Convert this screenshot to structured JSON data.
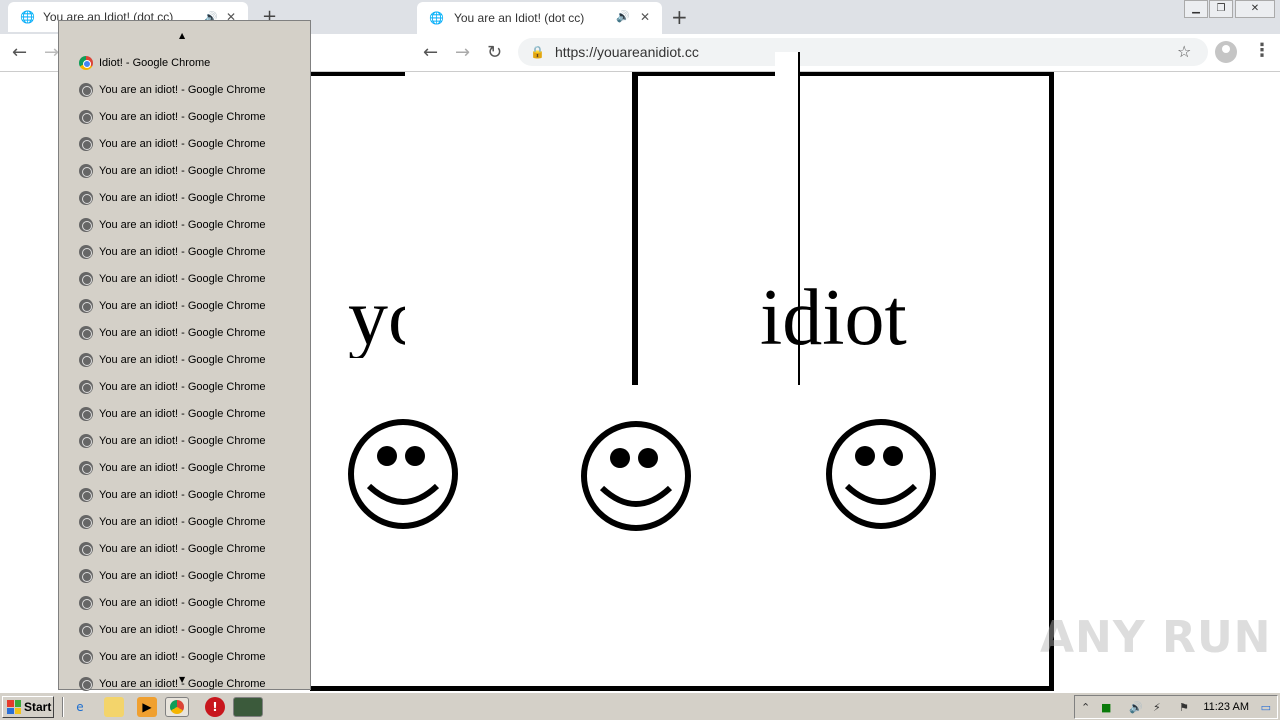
{
  "back_window": {
    "tab_title": "You are an Idiot! (dot cc)",
    "new_tab": "+",
    "back": "←",
    "forward": "→"
  },
  "front_window": {
    "tab_title": "You are an Idiot! (dot cc)",
    "new_tab": "+",
    "close_tab": "✕",
    "speaker": "🔊",
    "back": "←",
    "forward": "→",
    "reload": "↻",
    "url": "https://youareanidiot.cc",
    "lock": "🔒",
    "star": "☆",
    "menu": "⋮",
    "window_controls": {
      "minimize": "▁",
      "restore": "❐",
      "close": "✕"
    }
  },
  "page": {
    "text_left": "yo",
    "text_right": "idiot",
    "smiley_count": 3
  },
  "popup": {
    "scroll_up": "▲",
    "scroll_down": "▼",
    "items": [
      {
        "label": "Idiot! - Google Chrome",
        "icon": "chrome-icon"
      },
      {
        "label": "You are an idiot! - Google Chrome",
        "icon": "globe-icon"
      },
      {
        "label": "You are an idiot! - Google Chrome",
        "icon": "globe-icon"
      },
      {
        "label": "You are an idiot! - Google Chrome",
        "icon": "globe-icon"
      },
      {
        "label": "You are an idiot! - Google Chrome",
        "icon": "globe-icon"
      },
      {
        "label": "You are an idiot! - Google Chrome",
        "icon": "globe-icon"
      },
      {
        "label": "You are an idiot! - Google Chrome",
        "icon": "globe-icon"
      },
      {
        "label": "You are an idiot! - Google Chrome",
        "icon": "globe-icon"
      },
      {
        "label": "You are an idiot! - Google Chrome",
        "icon": "globe-icon"
      },
      {
        "label": "You are an idiot! - Google Chrome",
        "icon": "globe-icon"
      },
      {
        "label": "You are an idiot! - Google Chrome",
        "icon": "globe-icon"
      },
      {
        "label": "You are an idiot! - Google Chrome",
        "icon": "globe-icon"
      },
      {
        "label": "You are an idiot! - Google Chrome",
        "icon": "globe-icon"
      },
      {
        "label": "You are an idiot! - Google Chrome",
        "icon": "globe-icon"
      },
      {
        "label": "You are an idiot! - Google Chrome",
        "icon": "globe-icon"
      },
      {
        "label": "You are an idiot! - Google Chrome",
        "icon": "globe-icon"
      },
      {
        "label": "You are an idiot! - Google Chrome",
        "icon": "globe-icon"
      },
      {
        "label": "You are an idiot! - Google Chrome",
        "icon": "globe-icon"
      },
      {
        "label": "You are an idiot! - Google Chrome",
        "icon": "globe-icon"
      },
      {
        "label": "You are an idiot! - Google Chrome",
        "icon": "globe-icon"
      },
      {
        "label": "You are an idiot! - Google Chrome",
        "icon": "globe-icon"
      },
      {
        "label": "You are an idiot! - Google Chrome",
        "icon": "globe-icon"
      },
      {
        "label": "You are an idiot! - Google Chrome",
        "icon": "globe-icon"
      },
      {
        "label": "You are an idiot! - Google Chrome",
        "icon": "globe-icon"
      }
    ]
  },
  "watermark": "ANY RUN",
  "taskbar": {
    "start_label": "Start",
    "clock": "11:23 AM"
  }
}
